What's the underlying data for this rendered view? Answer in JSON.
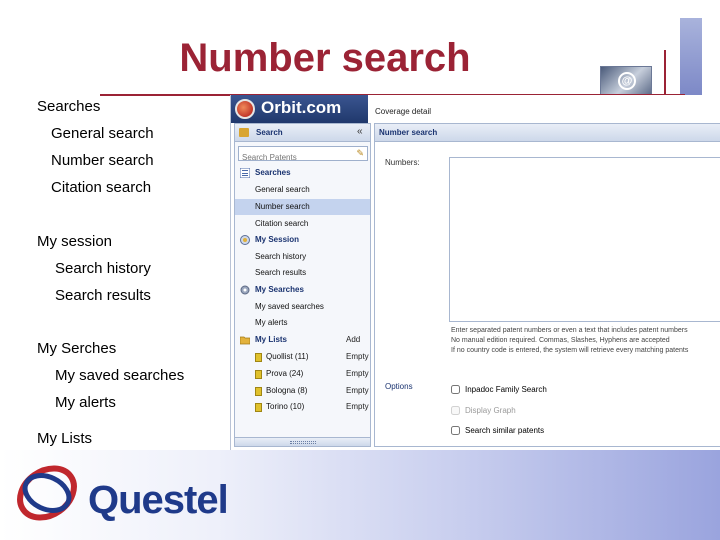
{
  "slide": {
    "title": "Number search",
    "outline": [
      {
        "label": "Searches",
        "level": 0
      },
      {
        "label": "General search",
        "level": 1
      },
      {
        "label": "Number search",
        "level": 1
      },
      {
        "label": "Citation search",
        "level": 1
      },
      {
        "label": "My session",
        "level": 0
      },
      {
        "label": "Search history",
        "level": 1
      },
      {
        "label": "Search results",
        "level": 1
      },
      {
        "label": "My Serches",
        "level": 0
      },
      {
        "label": "My saved searches",
        "level": 1
      },
      {
        "label": "My alerts",
        "level": 1
      },
      {
        "label": "My Lists",
        "level": 0
      }
    ],
    "logo_text": "Questel"
  },
  "app": {
    "brand": "Orbit.com",
    "coverage_link": "Coverage detail",
    "left_panel": {
      "header": "Search",
      "collapse": "«",
      "search_placeholder": "Search Patents",
      "sections": {
        "searches": "Searches",
        "general": "General search",
        "number": "Number search",
        "citation": "Citation search",
        "my_session": "My Session",
        "history": "Search history",
        "results": "Search results",
        "my_searches": "My Searches",
        "saved": "My saved searches",
        "alerts": "My alerts",
        "my_lists": "My Lists",
        "add": "Add"
      },
      "lists": [
        {
          "name": "Quollist (11)",
          "status": "Empty"
        },
        {
          "name": "Prova (24)",
          "status": "Empty"
        },
        {
          "name": "Bologna (8)",
          "status": "Empty"
        },
        {
          "name": "Torino (10)",
          "status": "Empty"
        }
      ]
    },
    "main_panel": {
      "header": "Number search",
      "numbers_label": "Numbers:",
      "help_lines": [
        "Enter separated patent numbers or even a text that includes patent numbers",
        "No manual edition required. Commas, Slashes, Hyphens are accepted",
        "If no country code is entered, the system will retrieve every matching patents"
      ],
      "options_label": "Options",
      "options": [
        {
          "label": "Inpadoc Family Search",
          "disabled": false
        },
        {
          "label": "Display Graph",
          "disabled": true
        },
        {
          "label": "Search similar patents",
          "disabled": false
        }
      ]
    }
  },
  "colors": {
    "title": "#9b2335",
    "brand_bar": "#20386c",
    "selection": "#c4d3ee",
    "logo_blue": "#1f3a8a"
  }
}
